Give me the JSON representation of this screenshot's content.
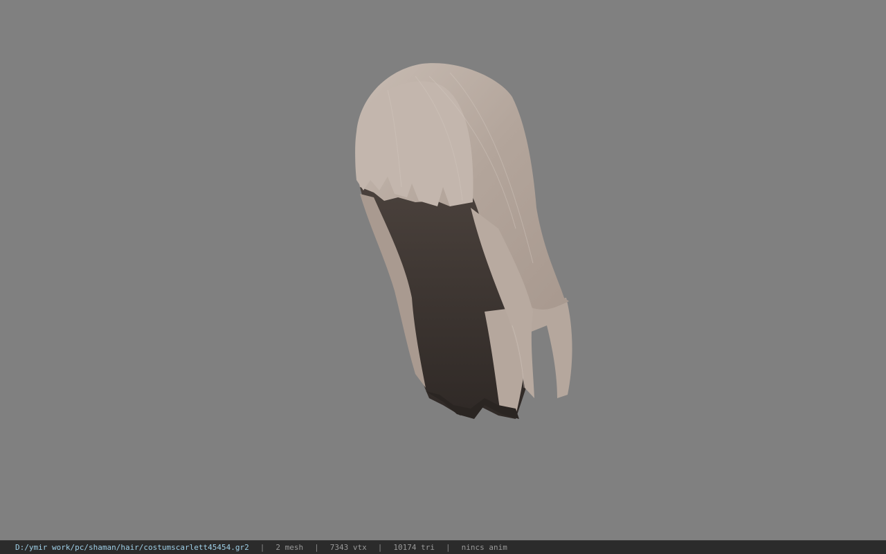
{
  "viewer": {
    "background_color": "#808080",
    "model": {
      "icon": "hair-mesh",
      "hair_light_color": "#b9aca3",
      "hair_dark_color": "#3b3431"
    }
  },
  "status_bar": {
    "path": "D:/ymir work/pc/shaman/hair/costumscarlett45454.gr2",
    "separator": "|",
    "mesh_count": "2 mesh",
    "vertex_count": "7343 vtx",
    "triangle_count": "10174 tri",
    "animation": "nincs anim"
  }
}
